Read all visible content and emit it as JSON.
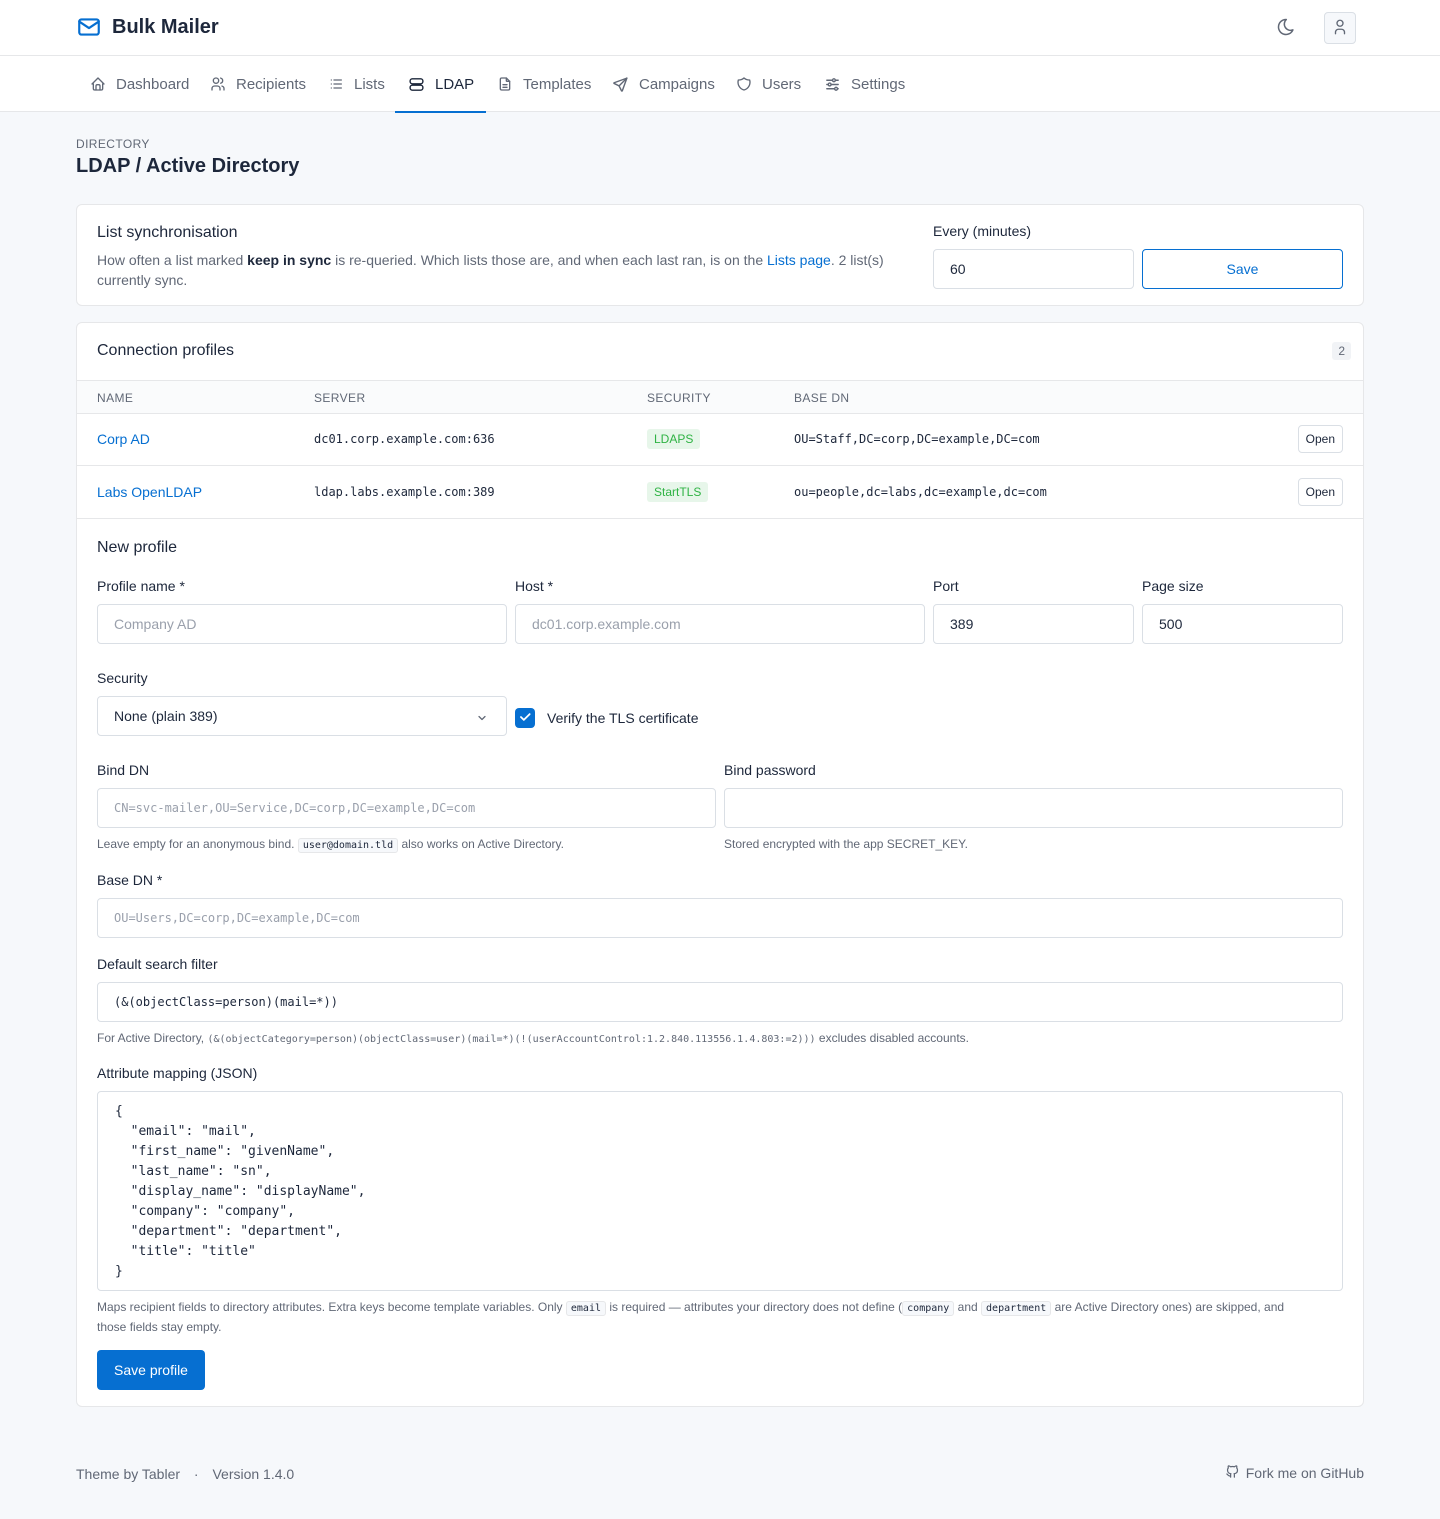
{
  "app": {
    "title": "Bulk Mailer"
  },
  "nav": [
    {
      "label": "Dashboard",
      "icon": "home-icon"
    },
    {
      "label": "Recipients",
      "icon": "users-icon"
    },
    {
      "label": "Lists",
      "icon": "list-icon"
    },
    {
      "label": "LDAP",
      "icon": "server-icon",
      "active": true
    },
    {
      "label": "Templates",
      "icon": "file-icon"
    },
    {
      "label": "Campaigns",
      "icon": "send-icon"
    },
    {
      "label": "Users",
      "icon": "shield-icon"
    },
    {
      "label": "Settings",
      "icon": "sliders-icon"
    }
  ],
  "page": {
    "pretitle": "DIRECTORY",
    "title": "LDAP / Active Directory"
  },
  "sync": {
    "title": "List synchronisation",
    "desc_1": "How often a list marked ",
    "desc_bold": "keep in sync",
    "desc_2": " is re-queried. Which lists those are, and when each last ran, is on the ",
    "desc_link": "Lists page",
    "desc_3": ". 2 list(s)",
    "desc_4": "currently sync.",
    "interval_label": "Every (minutes)",
    "interval_value": "60",
    "save_label": "Save"
  },
  "profiles": {
    "title": "Connection profiles",
    "count": "2",
    "columns": [
      "NAME",
      "SERVER",
      "SECURITY",
      "BASE DN"
    ],
    "rows": [
      {
        "name": "Corp AD",
        "server": "dc01.corp.example.com:636",
        "security": "LDAPS",
        "base_dn": "OU=Staff,DC=corp,DC=example,DC=com",
        "action": "Open"
      },
      {
        "name": "Labs OpenLDAP",
        "server": "ldap.labs.example.com:389",
        "security": "StartTLS",
        "base_dn": "ou=people,dc=labs,dc=example,dc=com",
        "action": "Open"
      }
    ]
  },
  "form": {
    "title": "New profile",
    "profile_name_label": "Profile name *",
    "profile_name_placeholder": "Company AD",
    "host_label": "Host *",
    "host_placeholder": "dc01.corp.example.com",
    "port_label": "Port",
    "port_value": "389",
    "page_size_label": "Page size",
    "page_size_value": "500",
    "security_label": "Security",
    "security_value": "None (plain 389)",
    "verify_label": "Verify the TLS certificate",
    "verify_checked": true,
    "bind_dn_label": "Bind DN",
    "bind_dn_placeholder": "CN=svc-mailer,OU=Service,DC=corp,DC=example,DC=com",
    "bind_dn_hint_1": "Leave empty for an anonymous bind.",
    "bind_dn_hint_code": "user@domain.tld",
    "bind_dn_hint_2": "also works on Active Directory.",
    "bind_pw_label": "Bind password",
    "bind_pw_hint": "Stored encrypted with the app SECRET_KEY.",
    "base_dn_label": "Base DN *",
    "base_dn_placeholder": "OU=Users,DC=corp,DC=example,DC=com",
    "filter_label": "Default search filter",
    "filter_value": "(&(objectClass=person)(mail=*))",
    "filter_hint_1": "For Active Directory,",
    "filter_hint_code": "(&(objectCategory=person)(objectClass=user)(mail=*)(!(userAccountControl:1.2.840.113556.1.4.803:=2)))",
    "filter_hint_2": "excludes disabled accounts.",
    "mapping_label": "Attribute mapping (JSON)",
    "mapping_value": "{\n  \"email\": \"mail\",\n  \"first_name\": \"givenName\",\n  \"last_name\": \"sn\",\n  \"display_name\": \"displayName\",\n  \"company\": \"company\",\n  \"department\": \"department\",\n  \"title\": \"title\"\n}",
    "mapping_hint_1": "Maps recipient fields to directory attributes. Extra keys become template variables. Only",
    "mapping_hint_code1": "email",
    "mapping_hint_2": "is required — attributes your directory does not define (",
    "mapping_hint_code2": "company",
    "mapping_hint_3": "and",
    "mapping_hint_code3": "department",
    "mapping_hint_4": "are Active Directory ones) are skipped, and",
    "mapping_hint_5": "those fields stay empty.",
    "save_label": "Save profile"
  },
  "footer": {
    "theme": "Theme by Tabler",
    "sep": "·",
    "version": "Version 1.4.0",
    "github": "Fork me on GitHub"
  },
  "colors": {
    "primary": "#066fd1",
    "success": "#2fb344",
    "text": "#1d273b",
    "muted": "#616876"
  }
}
